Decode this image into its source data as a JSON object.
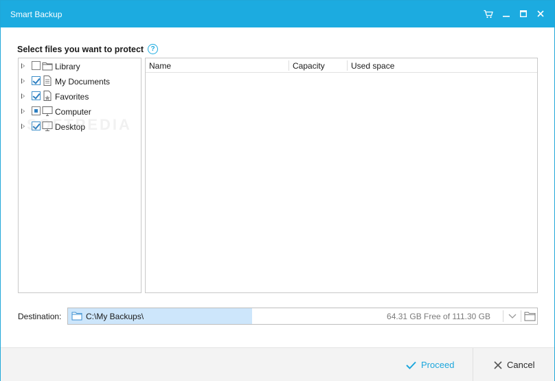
{
  "window": {
    "title": "Smart Backup"
  },
  "titlebar_icons": [
    "cart-icon",
    "minimize-icon",
    "maximize-icon",
    "close-icon"
  ],
  "heading": "Select files you want to protect",
  "tree": {
    "items": [
      {
        "label": "Library",
        "state": "unchecked",
        "icon": "folder-icon"
      },
      {
        "label": "My Documents",
        "state": "checked",
        "icon": "document-icon"
      },
      {
        "label": "Favorites",
        "state": "checked",
        "icon": "favorites-icon"
      },
      {
        "label": "Computer",
        "state": "partial",
        "icon": "computer-icon"
      },
      {
        "label": "Desktop",
        "state": "checked",
        "icon": "monitor-icon"
      }
    ]
  },
  "list": {
    "columns": [
      "Name",
      "Capacity",
      "Used space"
    ]
  },
  "watermark": "SOFTPEDIA",
  "destination": {
    "label": "Destination:",
    "path": "C:\\My Backups\\",
    "free_space": "64.31 GB Free of 111.30 GB"
  },
  "footer": {
    "proceed_label": "Proceed",
    "cancel_label": "Cancel"
  },
  "colors": {
    "accent": "#1cabe0",
    "selection": "#cde6fb"
  }
}
